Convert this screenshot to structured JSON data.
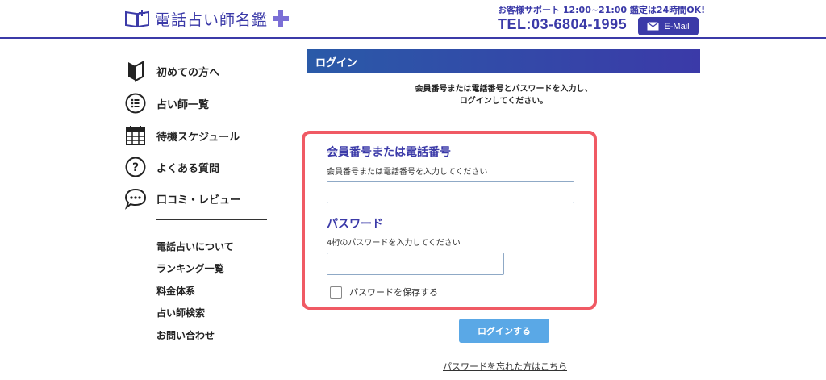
{
  "header": {
    "logo_text": "電話占い師名鑑",
    "logo_badge": "プラス",
    "support_hours": "お客様サポート 12:00~21:00  鑑定は24時間OK!",
    "tel": "TEL:03-6804-1995",
    "email_label": "E-Mail",
    "brand_color": "#3b3aa8"
  },
  "sidebar": {
    "items": [
      {
        "label": "初めての方へ",
        "icon": "beginner-mark-icon"
      },
      {
        "label": "占い師一覧",
        "icon": "list-icon"
      },
      {
        "label": "待機スケジュール",
        "icon": "calendar-icon"
      },
      {
        "label": "よくある質問",
        "icon": "question-icon"
      },
      {
        "label": "口コミ・レビュー",
        "icon": "speech-bubble-icon"
      }
    ],
    "links": [
      "電話占いについて",
      "ランキング一覧",
      "料金体系",
      "占い師検索",
      "お問い合わせ"
    ]
  },
  "main": {
    "section_title": "ログイン",
    "instruction_line1": "会員番号または電話番号とパスワードを入力し、",
    "instruction_line2": "ログインしてください。",
    "member": {
      "title": "会員番号または電話番号",
      "note": "会員番号または電話番号を入力してください",
      "value": ""
    },
    "password": {
      "title": "パスワード",
      "note": "4桁のパスワードを入力してください",
      "value": ""
    },
    "remember_label": "パスワードを保存する",
    "remember_checked": false,
    "login_button": "ログインする",
    "forgot_link": "パスワードを忘れた方はこちら",
    "highlight_color": "#f05a64",
    "button_color": "#5aa8e6"
  }
}
